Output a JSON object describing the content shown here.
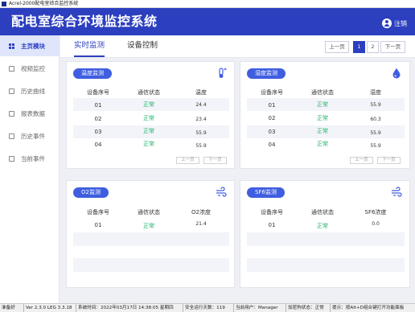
{
  "window": {
    "title": "Acrel-2000配电室综合监控系统"
  },
  "header": {
    "title": "配电室综合环境监控系统",
    "logout_label": "注销"
  },
  "sidebar": {
    "items": [
      {
        "label": "主页模块",
        "active": true
      },
      {
        "label": "视频监控"
      },
      {
        "label": "历史曲线"
      },
      {
        "label": "报表数据"
      },
      {
        "label": "历史事件"
      },
      {
        "label": "当前事件"
      }
    ]
  },
  "tabs": [
    {
      "label": "实时监测",
      "active": true
    },
    {
      "label": "设备控制"
    }
  ],
  "pagination": {
    "prev": "上一页",
    "pages": [
      "1",
      "2"
    ],
    "next": "下一页",
    "current": "1"
  },
  "panels": {
    "temperature": {
      "title": "温度监测",
      "icon": "thermometer-icon",
      "columns": [
        "设备序号",
        "通信状态",
        "温度"
      ],
      "rows": [
        [
          "01",
          "正常",
          "24.4"
        ],
        [
          "02",
          "正常",
          "23.4"
        ],
        [
          "03",
          "正常",
          "55.9"
        ],
        [
          "04",
          "正常",
          "55.9"
        ]
      ],
      "prev": "上一页",
      "next": "下一页"
    },
    "humidity": {
      "title": "湿度监测",
      "icon": "water-drop-icon",
      "columns": [
        "设备序号",
        "通信状态",
        "湿度"
      ],
      "rows": [
        [
          "01",
          "正常",
          "55.9"
        ],
        [
          "02",
          "正常",
          "60.3"
        ],
        [
          "03",
          "正常",
          "55.9"
        ],
        [
          "04",
          "正常",
          "55.9"
        ]
      ],
      "prev": "上一页",
      "next": "下一页"
    },
    "o2": {
      "title": "O2监测",
      "icon": "wind-icon",
      "columns": [
        "设备序号",
        "通信状态",
        "O2浓度"
      ],
      "rows": [
        [
          "01",
          "正常",
          "21.4"
        ]
      ]
    },
    "sf6": {
      "title": "SF6监测",
      "icon": "wind-icon",
      "columns": [
        "设备序号",
        "通信状态",
        "SF6浓度"
      ],
      "rows": [
        [
          "01",
          "正常",
          "0.0"
        ]
      ]
    }
  },
  "statusbar": [
    "准备好",
    "Ver 2.3.0 LEG 3.3.18",
    "系统时间：2022年03月17日 14:38:05 星期四",
    "安全运行天数：119",
    "当前用户：Manager",
    "加密狗状态：正常",
    "提示：按Alt+D组合键打开功能面板"
  ],
  "colors": {
    "primary": "#2c3fbf",
    "badge": "#3f5ee0",
    "ok": "#1cb56a"
  }
}
